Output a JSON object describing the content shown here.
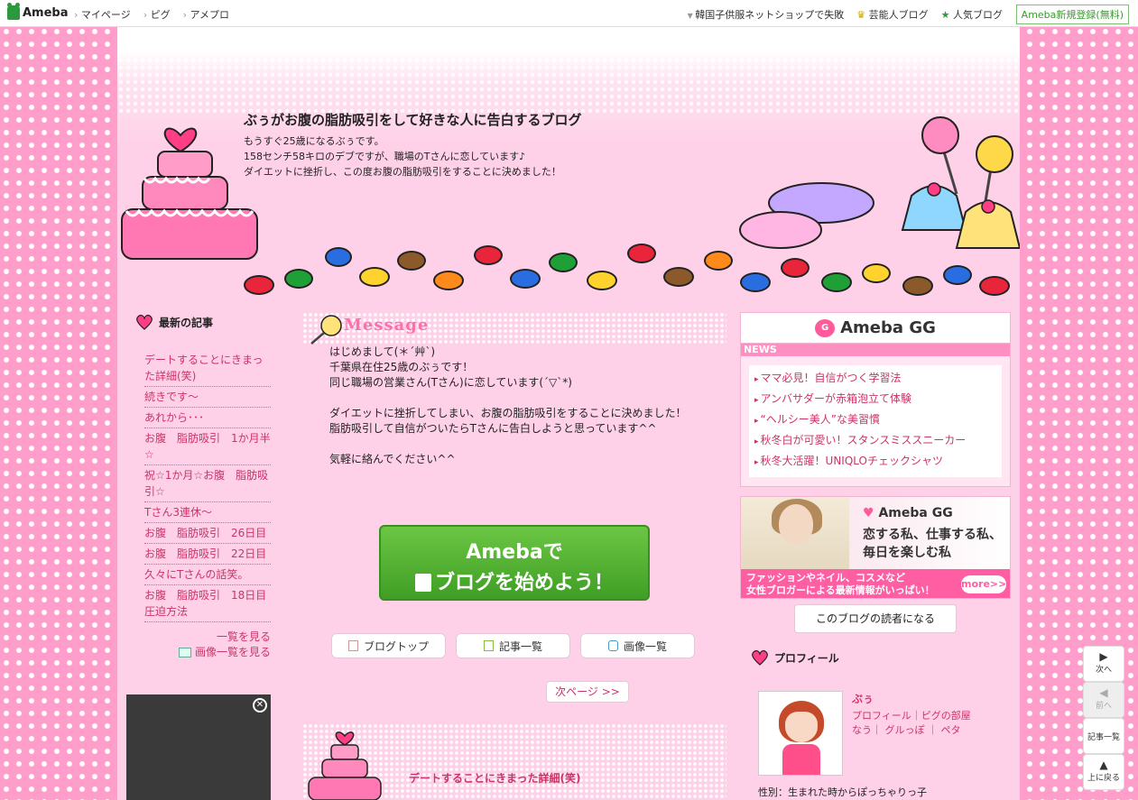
{
  "topbar": {
    "logo": "Ameba",
    "nav": [
      "マイページ",
      "ピグ",
      "アメプロ"
    ],
    "right_links": [
      "韓国子供服ネットショップで失敗",
      "芸能人ブログ",
      "人気ブログ"
    ],
    "signup": "Ameba新規登録(無料)"
  },
  "header": {
    "title": "ぶぅがお腹の脂肪吸引をして好きな人に告白するブログ",
    "desc": [
      "もうすぐ25歳になるぶぅです。",
      "158センチ58キロのデブですが、職場のTさんに恋しています♪",
      "ダイエットに挫折し、この度お腹の脂肪吸引をすることに決めました！"
    ]
  },
  "sidebar": {
    "heading": "最新の記事",
    "items": [
      "デートすることにきまった詳細(笑)",
      "続きです～",
      "あれから･･･",
      "お腹　脂肪吸引　1か月半☆",
      "祝☆1か月☆お腹　脂肪吸引☆",
      "Tさん3連休～",
      "お腹　脂肪吸引　26日目",
      "お腹　脂肪吸引　22日目",
      "久々にTさんの話笑。",
      "お腹　脂肪吸引　18日目 圧迫方法"
    ],
    "see_all": "一覧を見る",
    "image_list": "画像一覧を見る"
  },
  "message": {
    "title": "Message",
    "lines": [
      "はじめまして(＊´艸`)",
      "千葉県在住25歳のぶぅです！",
      "同じ職場の営業さん(Tさん)に恋しています(´▽`*)",
      "",
      "ダイエットに挫折してしまい、お腹の脂肪吸引をすることに決めました！",
      "脂肪吸引して自信がついたらTさんに告白しようと思っています^^",
      "",
      "気軽に絡んでください^^"
    ],
    "start_btn_line1": "Amebaで",
    "start_btn_line2": "ブログを始めよう！"
  },
  "pills": {
    "blog_top": "ブログトップ",
    "article_list": "記事一覧",
    "image_list": "画像一覧"
  },
  "next_page": "次ページ >>",
  "entry": {
    "title": "デートすることにきまった詳細(笑)"
  },
  "gg": {
    "brand": "Ameba GG",
    "news_label": "NEWS",
    "news": [
      "ママ必見！自信がつく学習法",
      "アンバサダーが赤箱泡立て体験",
      "“ヘルシー美人”な美習慣",
      "秋冬白が可愛い！スタンスミススニーカー",
      "秋冬大活躍！UNIQLOチェックシャツ"
    ]
  },
  "banner": {
    "brand": "Ameba GG",
    "copy1": "恋する私、仕事する私、",
    "copy2": "毎日を楽しむ私",
    "strip1": "ファッションやネイル、コスメなど",
    "strip2": "女性ブロガーによる最新情報がいっぱい！",
    "more": "more>>"
  },
  "reader_btn": "このブログの読者になる",
  "profile": {
    "heading": "プロフィール",
    "name": "ぶぅ",
    "links1": "プロフィール｜ピグの部屋",
    "links2": "なう｜ グルっぽ ｜ ペタ",
    "gender": "性別：生まれた時からぽっちゃりっ子"
  },
  "floatnav": {
    "next": "次へ",
    "prev": "前へ",
    "list": "記事一覧",
    "top": "上に戻る"
  },
  "colors": {
    "link": "#cc3366",
    "page_bg": "#ffd1e8",
    "outer_bg": "#ff9ecb",
    "button_green": "#4caf2f"
  }
}
